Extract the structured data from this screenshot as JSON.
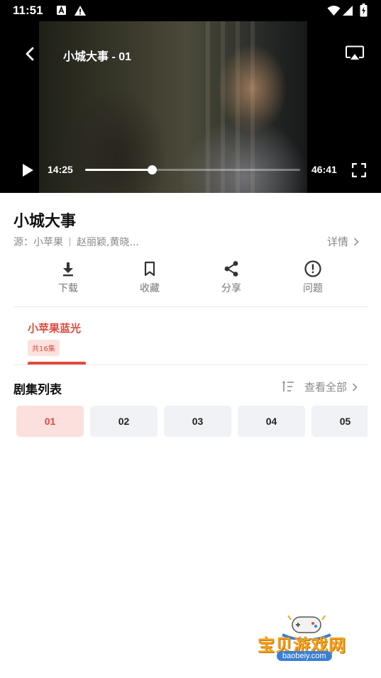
{
  "status_bar": {
    "time": "11:51",
    "icons": [
      "notification-a-icon",
      "warning-icon",
      "wifi-icon",
      "signal-icon",
      "battery-charging-icon"
    ]
  },
  "player": {
    "title": "小城大事 - 01",
    "current_time": "14:25",
    "total_time": "46:41",
    "progress": 0.309,
    "icons": [
      "back-arrow-icon",
      "cast-icon",
      "play-icon",
      "fullscreen-icon"
    ]
  },
  "show": {
    "title": "小城大事",
    "source_label": "源：小苹果",
    "cast": "赵丽颖,黄晓...",
    "details_label": "详情"
  },
  "actions": [
    {
      "label": "下载",
      "icon": "download-icon"
    },
    {
      "label": "收藏",
      "icon": "bookmark-icon"
    },
    {
      "label": "分享",
      "icon": "share-icon"
    },
    {
      "label": "问题",
      "icon": "report-icon"
    }
  ],
  "source_tab": {
    "name": "小苹果蓝光",
    "count": "共16集"
  },
  "episode_list": {
    "title": "剧集列表",
    "view_all_label": "查看全部",
    "episodes": [
      "01",
      "02",
      "03",
      "04",
      "05"
    ],
    "selected": "01"
  },
  "colors": {
    "accent": "#e04b3e",
    "accent_light": "#fbe0dd",
    "chip_bg": "#f1f2f5"
  },
  "watermark": {
    "text": "宝贝游戏网",
    "url": "baobeiy.com"
  }
}
